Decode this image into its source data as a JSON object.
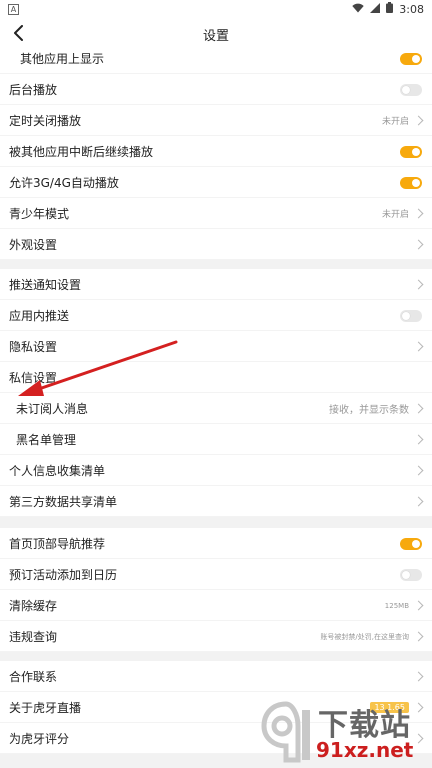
{
  "status": {
    "left_badge": "A",
    "time": "3:08"
  },
  "nav": {
    "title": "设置"
  },
  "rows": [
    {
      "label": "其他应用上显示",
      "control": "toggle",
      "on": true
    },
    {
      "label": "后台播放",
      "control": "toggle",
      "on": false
    },
    {
      "label": "定时关闭播放",
      "control": "value",
      "value": "未开启"
    },
    {
      "label": "被其他应用中断后继续播放",
      "control": "toggle",
      "on": true
    },
    {
      "label": "允许3G/4G自动播放",
      "control": "toggle",
      "on": true
    },
    {
      "label": "青少年模式",
      "control": "value",
      "value": "未开启"
    },
    {
      "label": "外观设置",
      "control": "chevron"
    },
    {
      "label": "推送通知设置",
      "control": "chevron"
    },
    {
      "label": "应用内推送",
      "control": "toggle",
      "on": false
    },
    {
      "label": "隐私设置",
      "control": "chevron"
    },
    {
      "label": "私信设置",
      "control": "none"
    },
    {
      "label": "未订阅人消息",
      "control": "value",
      "value": "接收，并显示条数"
    },
    {
      "label": "黑名单管理",
      "control": "chevron"
    },
    {
      "label": "个人信息收集清单",
      "control": "chevron"
    },
    {
      "label": "第三方数据共享清单",
      "control": "chevron"
    },
    {
      "label": "首页顶部导航推荐",
      "control": "toggle",
      "on": true
    },
    {
      "label": "预订活动添加到日历",
      "control": "toggle",
      "on": false
    },
    {
      "label": "清除缓存",
      "control": "value",
      "value": "125MB"
    },
    {
      "label": "违规查询",
      "control": "value",
      "value": "账号被封禁/处罚,在这里查询"
    },
    {
      "label": "合作联系",
      "control": "chevron"
    },
    {
      "label": "关于虎牙直播",
      "control": "badge",
      "value": "13.1.65"
    },
    {
      "label": "为虎牙评分",
      "control": "chevron"
    }
  ],
  "watermark": {
    "line1": "下载站",
    "line2": "91xz.net"
  },
  "colors": {
    "accent": "#f7a90d",
    "arrow": "#d42020"
  }
}
